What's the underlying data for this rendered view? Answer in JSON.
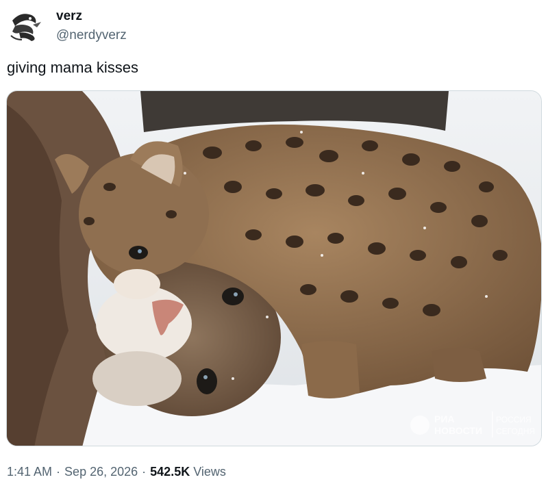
{
  "author": {
    "display_name": "verz",
    "handle": "@nerdyverz"
  },
  "tweet": {
    "text": "giving mama kisses"
  },
  "media": {
    "watermark_line1": "РИА",
    "watermark_line2": "НОВОСТИ",
    "watermark_right1": "РОССИЯ",
    "watermark_right2": "СЕГОДНЯ"
  },
  "meta": {
    "time": "1:41 AM",
    "separator": "·",
    "date": "Sep 26, 2026",
    "views_count": "542.5K",
    "views_label": "Views"
  },
  "colors": {
    "text_primary": "#0f1419",
    "text_secondary": "#536471",
    "border": "#cfd9de"
  }
}
